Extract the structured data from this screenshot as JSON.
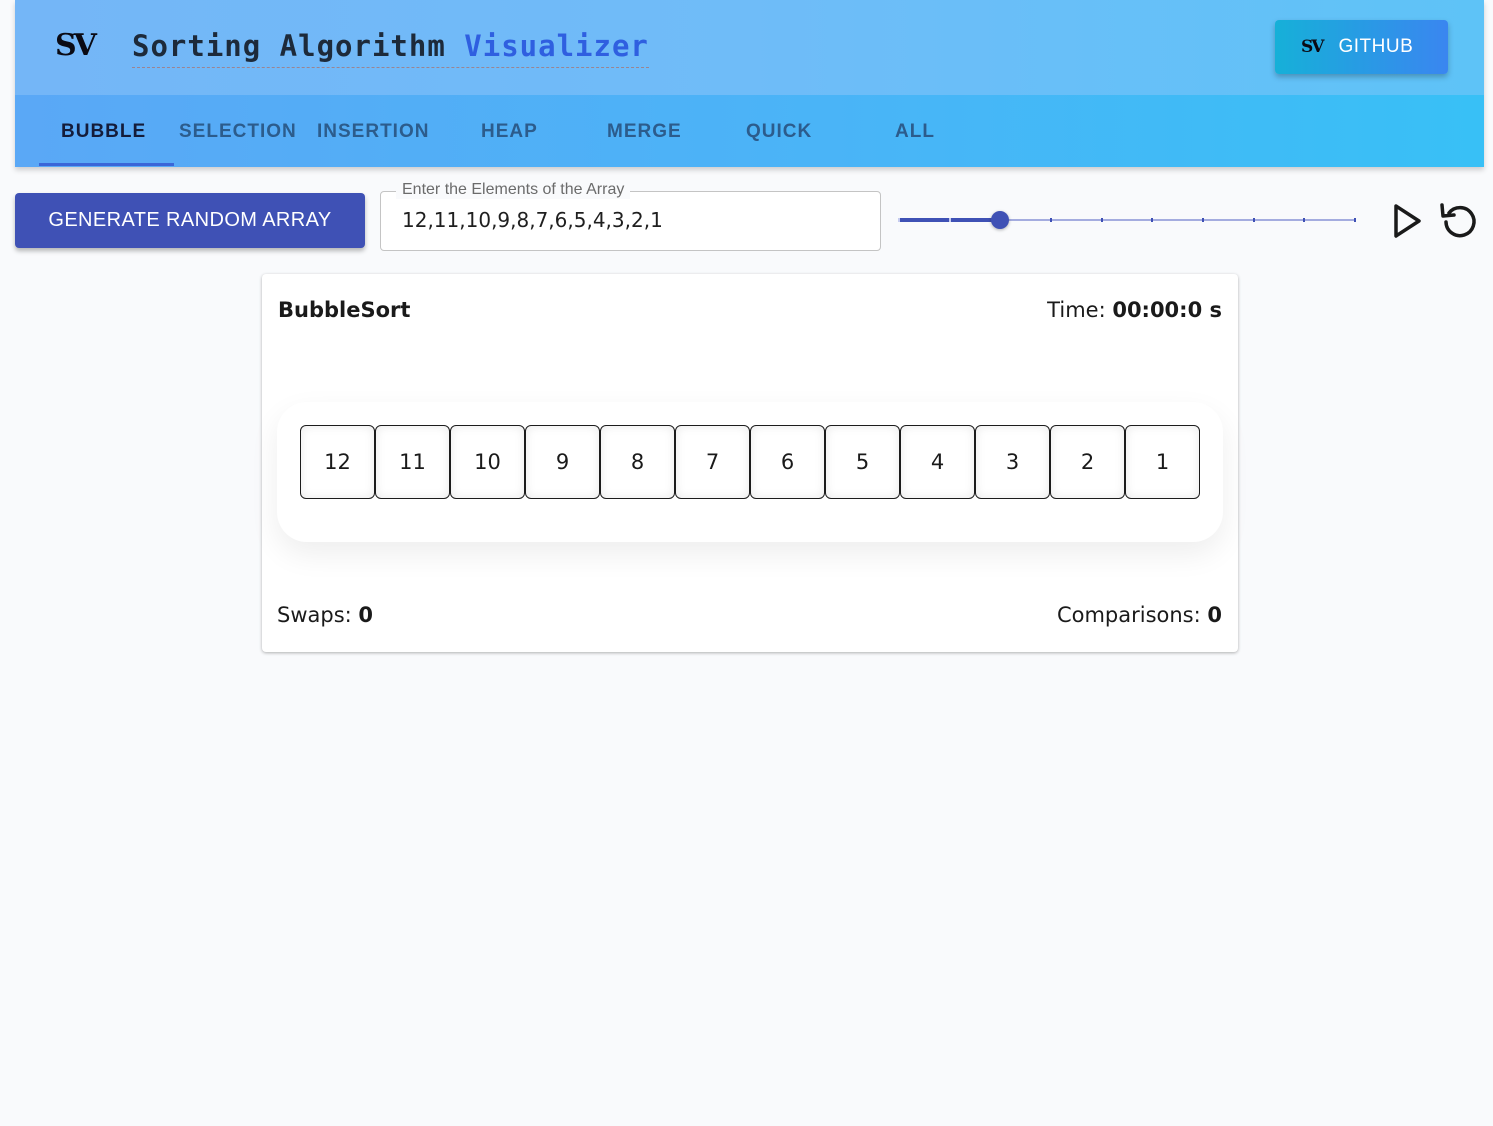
{
  "header": {
    "logo_text": "SV",
    "title_prefix": "Sorting Algorithm",
    "title_accent": "Visualizer",
    "github_logo_text": "SV",
    "github_label": "GITHUB"
  },
  "tabs": [
    {
      "label": "BUBBLE",
      "active": true
    },
    {
      "label": "SELECTION",
      "active": false
    },
    {
      "label": "INSERTION",
      "active": false
    },
    {
      "label": "HEAP",
      "active": false
    },
    {
      "label": "MERGE",
      "active": false
    },
    {
      "label": "QUICK",
      "active": false
    },
    {
      "label": "ALL",
      "active": false
    }
  ],
  "controls": {
    "generate_label": "GENERATE RANDOM ARRAY",
    "array_field_label": "Enter the Elements of the Array",
    "array_value": "12,11,10,9,8,7,6,5,4,3,2,1",
    "speed": {
      "min": 0,
      "max": 9,
      "step": 1,
      "value": 2
    },
    "play_icon": "play-icon",
    "reset_icon": "reset-icon"
  },
  "colors": {
    "primary": "#3f51b5",
    "accent": "#2f5fe0",
    "rail": "#a4acdf"
  },
  "visualizer": {
    "title": "BubbleSort",
    "time_label": "Time:",
    "time_value": "00:00:0 s",
    "array": [
      "12",
      "11",
      "10",
      "9",
      "8",
      "7",
      "6",
      "5",
      "4",
      "3",
      "2",
      "1"
    ],
    "swaps_label": "Swaps:",
    "swaps_value": "0",
    "comparisons_label": "Comparisons:",
    "comparisons_value": "0"
  }
}
